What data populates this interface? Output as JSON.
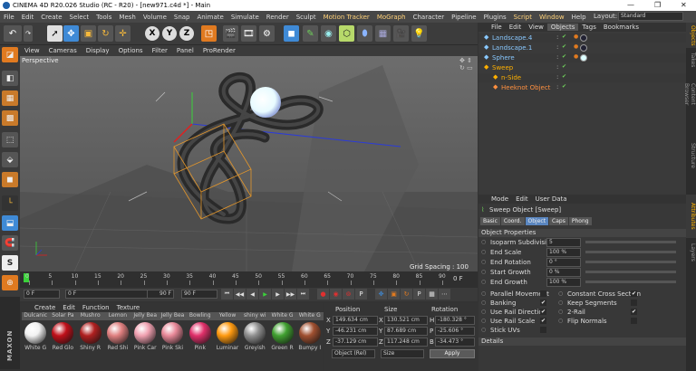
{
  "window": {
    "title": "CINEMA 4D R20.026 Studio (RC - R20) - [new971.c4d *] - Main",
    "min": "—",
    "max": "❐",
    "close": "✕"
  },
  "menu": [
    "File",
    "Edit",
    "Create",
    "Select",
    "Tools",
    "Mesh",
    "Volume",
    "Snap",
    "Animate",
    "Simulate",
    "Render",
    "Sculpt",
    "Motion Tracker",
    "MoGraph",
    "Character",
    "Pipeline",
    "Plugins",
    "Script",
    "Window",
    "Help"
  ],
  "layout": {
    "label": "Layout:",
    "value": "Standard"
  },
  "viewport": {
    "menu": [
      "View",
      "Cameras",
      "Display",
      "Options",
      "Filter",
      "Panel",
      "ProRender"
    ],
    "label": "Perspective",
    "grid": "Grid Spacing : 100 cm"
  },
  "timeline": {
    "ticks": [
      "0",
      "5",
      "10",
      "15",
      "20",
      "25",
      "30",
      "35",
      "40",
      "45",
      "50",
      "55",
      "60",
      "65",
      "70",
      "75",
      "80",
      "85",
      "90"
    ],
    "end": "0 F"
  },
  "transport": {
    "start": "0 F",
    "cur": "0 F",
    "end1": "90 F",
    "end2": "90 F"
  },
  "materials": {
    "menu": [
      "Create",
      "Edit",
      "Function",
      "Texture"
    ],
    "row1": [
      "Dulcanic",
      "Solar Pa",
      "Mushro",
      "Lemon",
      "Jelly Bea",
      "Jelly Bea",
      "Bowling",
      "Yellow",
      "shiny wi",
      "White G",
      "White G"
    ],
    "row2": [
      {
        "name": "White G",
        "color": "#f2f2f2"
      },
      {
        "name": "Red Glo",
        "color": "#c0101a"
      },
      {
        "name": "Shiny R",
        "color": "#b02020"
      },
      {
        "name": "Red Shi",
        "color": "#e08080"
      },
      {
        "name": "Pink Car",
        "color": "#f0a0b0"
      },
      {
        "name": "Pink Ski",
        "color": "#e88898"
      },
      {
        "name": "Pink",
        "color": "#e0306a"
      },
      {
        "name": "Luminar",
        "color": "#ff9a10"
      },
      {
        "name": "Greyish",
        "color": "#909090"
      },
      {
        "name": "Green R",
        "color": "#40a030"
      },
      {
        "name": "Bumpy I",
        "color": "#a05030"
      }
    ]
  },
  "coords": {
    "headers": [
      "Position",
      "Size",
      "Rotation"
    ],
    "rows": [
      {
        "axis": "X",
        "pos": "149.634 cm",
        "size": "130.521 cm",
        "raxis": "H",
        "rot": "-180.328 °"
      },
      {
        "axis": "Y",
        "pos": "-46.231 cm",
        "size": "87.689 cm",
        "raxis": "P",
        "rot": "-25.606 °"
      },
      {
        "axis": "Z",
        "pos": "-37.129 cm",
        "size": "117.248 cm",
        "raxis": "B",
        "rot": "-34.473 °"
      }
    ],
    "mode1": "Object (Rel)",
    "mode2": "Size",
    "apply": "Apply"
  },
  "objects": {
    "menu": [
      "File",
      "Edit",
      "View",
      "Objects",
      "Tags",
      "Bookmarks"
    ],
    "items": [
      {
        "name": "Landscape.4",
        "color": "#88c8ff",
        "indent": 0
      },
      {
        "name": "Landscape.1",
        "color": "#88c8ff",
        "indent": 0
      },
      {
        "name": "Sphere",
        "color": "#88c8ff",
        "indent": 0
      },
      {
        "name": "Sweep",
        "color": "#ffb000",
        "indent": 0
      },
      {
        "name": "n-Side",
        "color": "#ffb000",
        "indent": 1
      },
      {
        "name": "Heeknot Object",
        "color": "#ff9040",
        "indent": 1
      }
    ]
  },
  "attributes": {
    "menu": [
      "Mode",
      "Edit",
      "User Data"
    ],
    "title": "Sweep Object [Sweep]",
    "tabs": [
      "Basic",
      "Coord.",
      "Object",
      "Caps",
      "Phong"
    ],
    "active_tab": "Object",
    "section": "Object Properties",
    "props": [
      {
        "label": "Isoparm Subdivision",
        "value": "5"
      },
      {
        "label": "End Scale",
        "value": "100 %"
      },
      {
        "label": "End Rotation",
        "value": "0 °"
      },
      {
        "label": "Start Growth",
        "value": "0 %"
      },
      {
        "label": "End Growth",
        "value": "100 %"
      }
    ],
    "checks_left": [
      {
        "label": "Parallel Movement",
        "on": false
      },
      {
        "label": "Banking",
        "on": true
      },
      {
        "label": "Use Rail Direction",
        "on": true
      },
      {
        "label": "Use Rail Scale",
        "on": true
      },
      {
        "label": "Stick UVs",
        "on": false
      }
    ],
    "checks_right": [
      {
        "label": "Constant Cross Section",
        "on": true
      },
      {
        "label": "Keep Segments",
        "on": false
      },
      {
        "label": "2-Rail",
        "on": true
      },
      {
        "label": "Flip Normals",
        "on": false
      }
    ],
    "details": "Details"
  },
  "side_tabs": [
    "Objects",
    "Takes",
    "Content Browser",
    "Structure",
    "Attributes",
    "Layers"
  ]
}
